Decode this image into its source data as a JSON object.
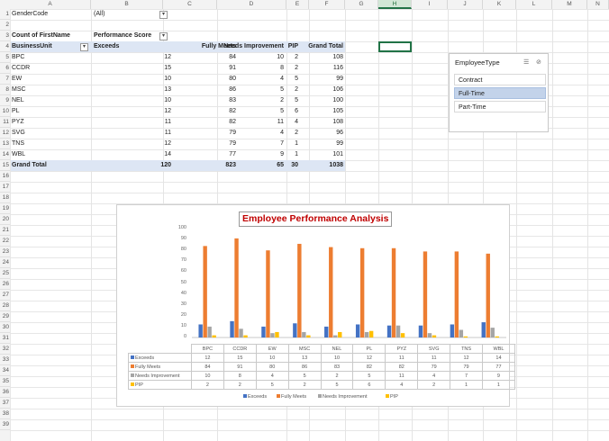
{
  "sheet": {
    "columns": [
      "A",
      "B",
      "C",
      "D",
      "E",
      "F",
      "G",
      "H",
      "I",
      "J",
      "K",
      "L",
      "M",
      "N"
    ],
    "selected_column": "H",
    "rows": [
      "1",
      "2",
      "3",
      "4",
      "5",
      "6",
      "7",
      "8",
      "9",
      "10",
      "11",
      "12",
      "13",
      "14",
      "15",
      "16",
      "17",
      "18",
      "19",
      "20",
      "21",
      "22",
      "23",
      "24",
      "25",
      "26",
      "27",
      "28",
      "29",
      "30",
      "31",
      "32",
      "33",
      "34",
      "35",
      "36",
      "37",
      "38",
      "39"
    ]
  },
  "filter": {
    "label": "GenderCode",
    "value": "(All)"
  },
  "pivot": {
    "header_count": "Count of FirstName",
    "header_score": "Performance Score",
    "header_unit": "BusinessUnit",
    "col_headers": [
      "Exceeds",
      "Fully Meets",
      "Needs Improvement",
      "PIP",
      "Grand Total"
    ],
    "rows": [
      {
        "unit": "BPC",
        "v": [
          "12",
          "84",
          "10",
          "2",
          "108"
        ]
      },
      {
        "unit": "CCDR",
        "v": [
          "15",
          "91",
          "8",
          "2",
          "116"
        ]
      },
      {
        "unit": "EW",
        "v": [
          "10",
          "80",
          "4",
          "5",
          "99"
        ]
      },
      {
        "unit": "MSC",
        "v": [
          "13",
          "86",
          "5",
          "2",
          "106"
        ]
      },
      {
        "unit": "NEL",
        "v": [
          "10",
          "83",
          "2",
          "5",
          "100"
        ]
      },
      {
        "unit": "PL",
        "v": [
          "12",
          "82",
          "5",
          "6",
          "105"
        ]
      },
      {
        "unit": "PYZ",
        "v": [
          "11",
          "82",
          "11",
          "4",
          "108"
        ]
      },
      {
        "unit": "SVG",
        "v": [
          "11",
          "79",
          "4",
          "2",
          "96"
        ]
      },
      {
        "unit": "TNS",
        "v": [
          "12",
          "79",
          "7",
          "1",
          "99"
        ]
      },
      {
        "unit": "WBL",
        "v": [
          "14",
          "77",
          "9",
          "1",
          "101"
        ]
      }
    ],
    "total": {
      "label": "Grand Total",
      "v": [
        "120",
        "823",
        "65",
        "30",
        "1038"
      ]
    }
  },
  "slicer": {
    "title": "EmployeeType",
    "items": [
      {
        "label": "Contract",
        "active": false
      },
      {
        "label": "Full-Time",
        "active": true
      },
      {
        "label": "Part-Time",
        "active": false
      }
    ]
  },
  "chart_data": {
    "type": "bar",
    "title": "Employee Performance Analysis",
    "categories": [
      "BPC",
      "CCDR",
      "EW",
      "MSC",
      "NEL",
      "PL",
      "PYZ",
      "SVG",
      "TNS",
      "WBL"
    ],
    "ylim": [
      0,
      100
    ],
    "yticks": [
      0,
      10,
      20,
      30,
      40,
      50,
      60,
      70,
      80,
      90,
      100
    ],
    "series": [
      {
        "name": "Exceeds",
        "color": "#4472c4",
        "values": [
          12,
          15,
          10,
          13,
          10,
          12,
          11,
          11,
          12,
          14
        ]
      },
      {
        "name": "Fully Meets",
        "color": "#ed7d31",
        "values": [
          84,
          91,
          80,
          86,
          83,
          82,
          82,
          79,
          79,
          77
        ]
      },
      {
        "name": "Needs Improvement",
        "color": "#a5a5a5",
        "values": [
          10,
          8,
          4,
          5,
          2,
          5,
          11,
          4,
          7,
          9
        ]
      },
      {
        "name": "PIP",
        "color": "#ffc000",
        "values": [
          2,
          2,
          5,
          2,
          5,
          6,
          4,
          2,
          1,
          1
        ]
      }
    ],
    "legend": "bottom",
    "data_table": true
  }
}
